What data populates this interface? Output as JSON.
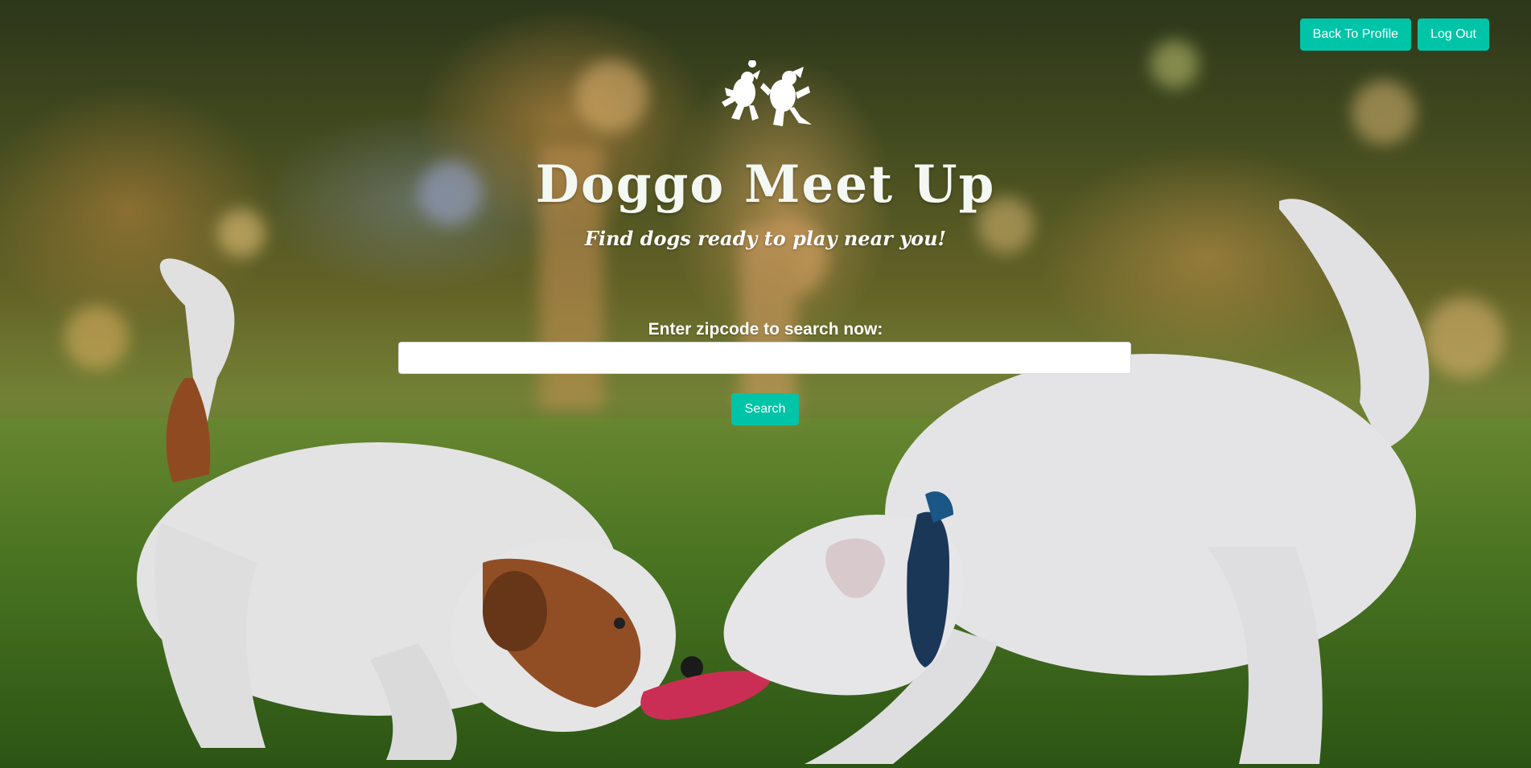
{
  "header": {
    "back_to_profile_label": "Back To Profile",
    "log_out_label": "Log Out"
  },
  "hero": {
    "title": "Doggo Meet Up",
    "subtitle": "Find dogs ready to play near you!",
    "logo_icon": "dancing-dogs-icon",
    "background_image": "two-terriers-playing-tug-on-grass"
  },
  "search": {
    "label": "Enter zipcode to search now:",
    "input_value": "",
    "input_placeholder": "",
    "button_label": "Search"
  },
  "colors": {
    "accent": "#00c4a7",
    "text": "#ffffff"
  }
}
